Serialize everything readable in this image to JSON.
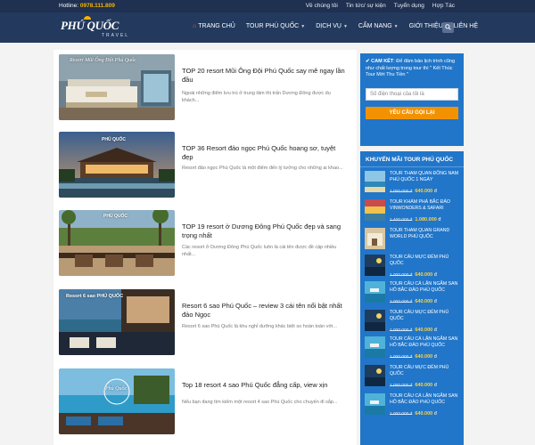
{
  "topbar": {
    "hotline_label": "Hotline:",
    "hotline_number": "0978.111.809",
    "links": [
      "Về chúng tôi",
      "Tin tức/ sự kiện",
      "Tuyển dụng",
      "Hợp Tác"
    ]
  },
  "logo": {
    "line1": "PHÚ QUỐC",
    "line2": "TRAVEL"
  },
  "nav": {
    "items": [
      {
        "label": "TRANG CHỦ",
        "icon": "home-icon",
        "has_dropdown": false
      },
      {
        "label": "TOUR PHÚ QUỐC",
        "has_dropdown": true
      },
      {
        "label": "DỊCH VỤ",
        "has_dropdown": true
      },
      {
        "label": "CẨM NANG",
        "has_dropdown": true
      },
      {
        "label": "GIỚI THIỆU",
        "has_dropdown": false
      },
      {
        "label": "LIÊN HỆ",
        "has_dropdown": false
      }
    ],
    "search_icon": "search-icon"
  },
  "posts": [
    {
      "thumb_caption": "Resort Mũi Ông Đội Phú Quốc",
      "title": "TOP 20 resort Mũi Ông Đội Phú Quốc say mê ngay lần đầu",
      "excerpt": "Ngoài những điểm lưu trú ở trung tâm thị trấn Dương Đông được du khách..."
    },
    {
      "thumb_caption": "PHÚ QUỐC",
      "title": "TOP 36 Resort đảo ngọc Phú Quốc hoang sơ, tuyệt đẹp",
      "excerpt": "Resort đảo ngọc Phú Quốc là một điểm đến lý tưởng cho những ai khao..."
    },
    {
      "thumb_caption": "PHÚ QUỐC",
      "title": "TOP 19 resort ở Dương Đông Phú Quốc đẹp và sang trọng nhất",
      "excerpt": "Các resort ở Dương Đông Phú Quốc luôn là cái tên được đề cập nhiều nhất..."
    },
    {
      "thumb_caption": "Resort 6 sao PHÚ QUỐC",
      "title": "Resort 6 sao Phú Quốc – review 3 cái tên nổi bật nhất đảo Ngọc",
      "excerpt": "Resort 6 sao Phú Quốc là khu nghỉ dưỡng khác biệt so hoàn toàn với..."
    },
    {
      "thumb_caption": "Phú Quốc",
      "title": "Top 18 resort 4 sao Phú Quốc đẳng cấp, view xịn",
      "excerpt": "Nếu bạn đang tìm kiếm một resort 4 sao Phú Quốc cho chuyến đi sắp..."
    }
  ],
  "callback": {
    "check_icon": "check-icon",
    "heading": "CAM KẾT",
    "text": "Để đảm bảo lịch trình cũng như chất lượng trong tour thì \" Kết Thúc Tour Mới Thu Tiền \"",
    "phone_placeholder": "Số điện thoại của tôi là",
    "button_label": "YÊU CẦU GỌI LẠI"
  },
  "promo": {
    "title": "KHUYẾN MÃI TOUR PHÚ QUỐC",
    "currency": "đ",
    "tours": [
      {
        "name": "TOUR THAM QUAN ĐÔNG NAM PHÚ QUỐC 1 NGÀY",
        "old_price": "1.000.000 đ",
        "new_price": "640.000"
      },
      {
        "name": "TOUR KHÁM PHÁ BẮC ĐẢO VINWONDERS & SAFARI",
        "old_price": "1.400.000 đ",
        "new_price": "1.080.000"
      },
      {
        "name": "TOUR THAM QUAN GRAND WORLD PHÚ QUỐC",
        "old_price": "",
        "new_price": ""
      },
      {
        "name": "TOUR CÂU MỰC ĐÊM PHÚ QUỐC",
        "old_price": "1.000.000 đ",
        "new_price": "640.000"
      },
      {
        "name": "TOUR CÂU CÁ LẶN NGẮM SAN HÔ BẮC ĐẢO PHÚ QUỐC",
        "old_price": "1.000.000 đ",
        "new_price": "640.000"
      },
      {
        "name": "TOUR CÂU MỰC ĐÊM PHÚ QUỐC",
        "old_price": "1.000.000 đ",
        "new_price": "640.000"
      },
      {
        "name": "TOUR CÂU CÁ LẶN NGẮM SAN HÔ BẮC ĐẢO PHÚ QUỐC",
        "old_price": "1.000.000 đ",
        "new_price": "640.000"
      },
      {
        "name": "TOUR CÂU MỰC ĐÊM PHÚ QUỐC",
        "old_price": "1.000.000 đ",
        "new_price": "640.000"
      },
      {
        "name": "TOUR CÂU CÁ LẶN NGẮM SAN HÔ BẮC ĐẢO PHÚ QUỐC",
        "old_price": "1.000.000 đ",
        "new_price": "640.000"
      }
    ]
  },
  "colors": {
    "header_bg": "#233a5e",
    "topbar_bg": "#1f3050",
    "sidebar_blue": "#2176c9",
    "accent_orange": "#f39200",
    "price_yellow": "#ffd33d"
  }
}
